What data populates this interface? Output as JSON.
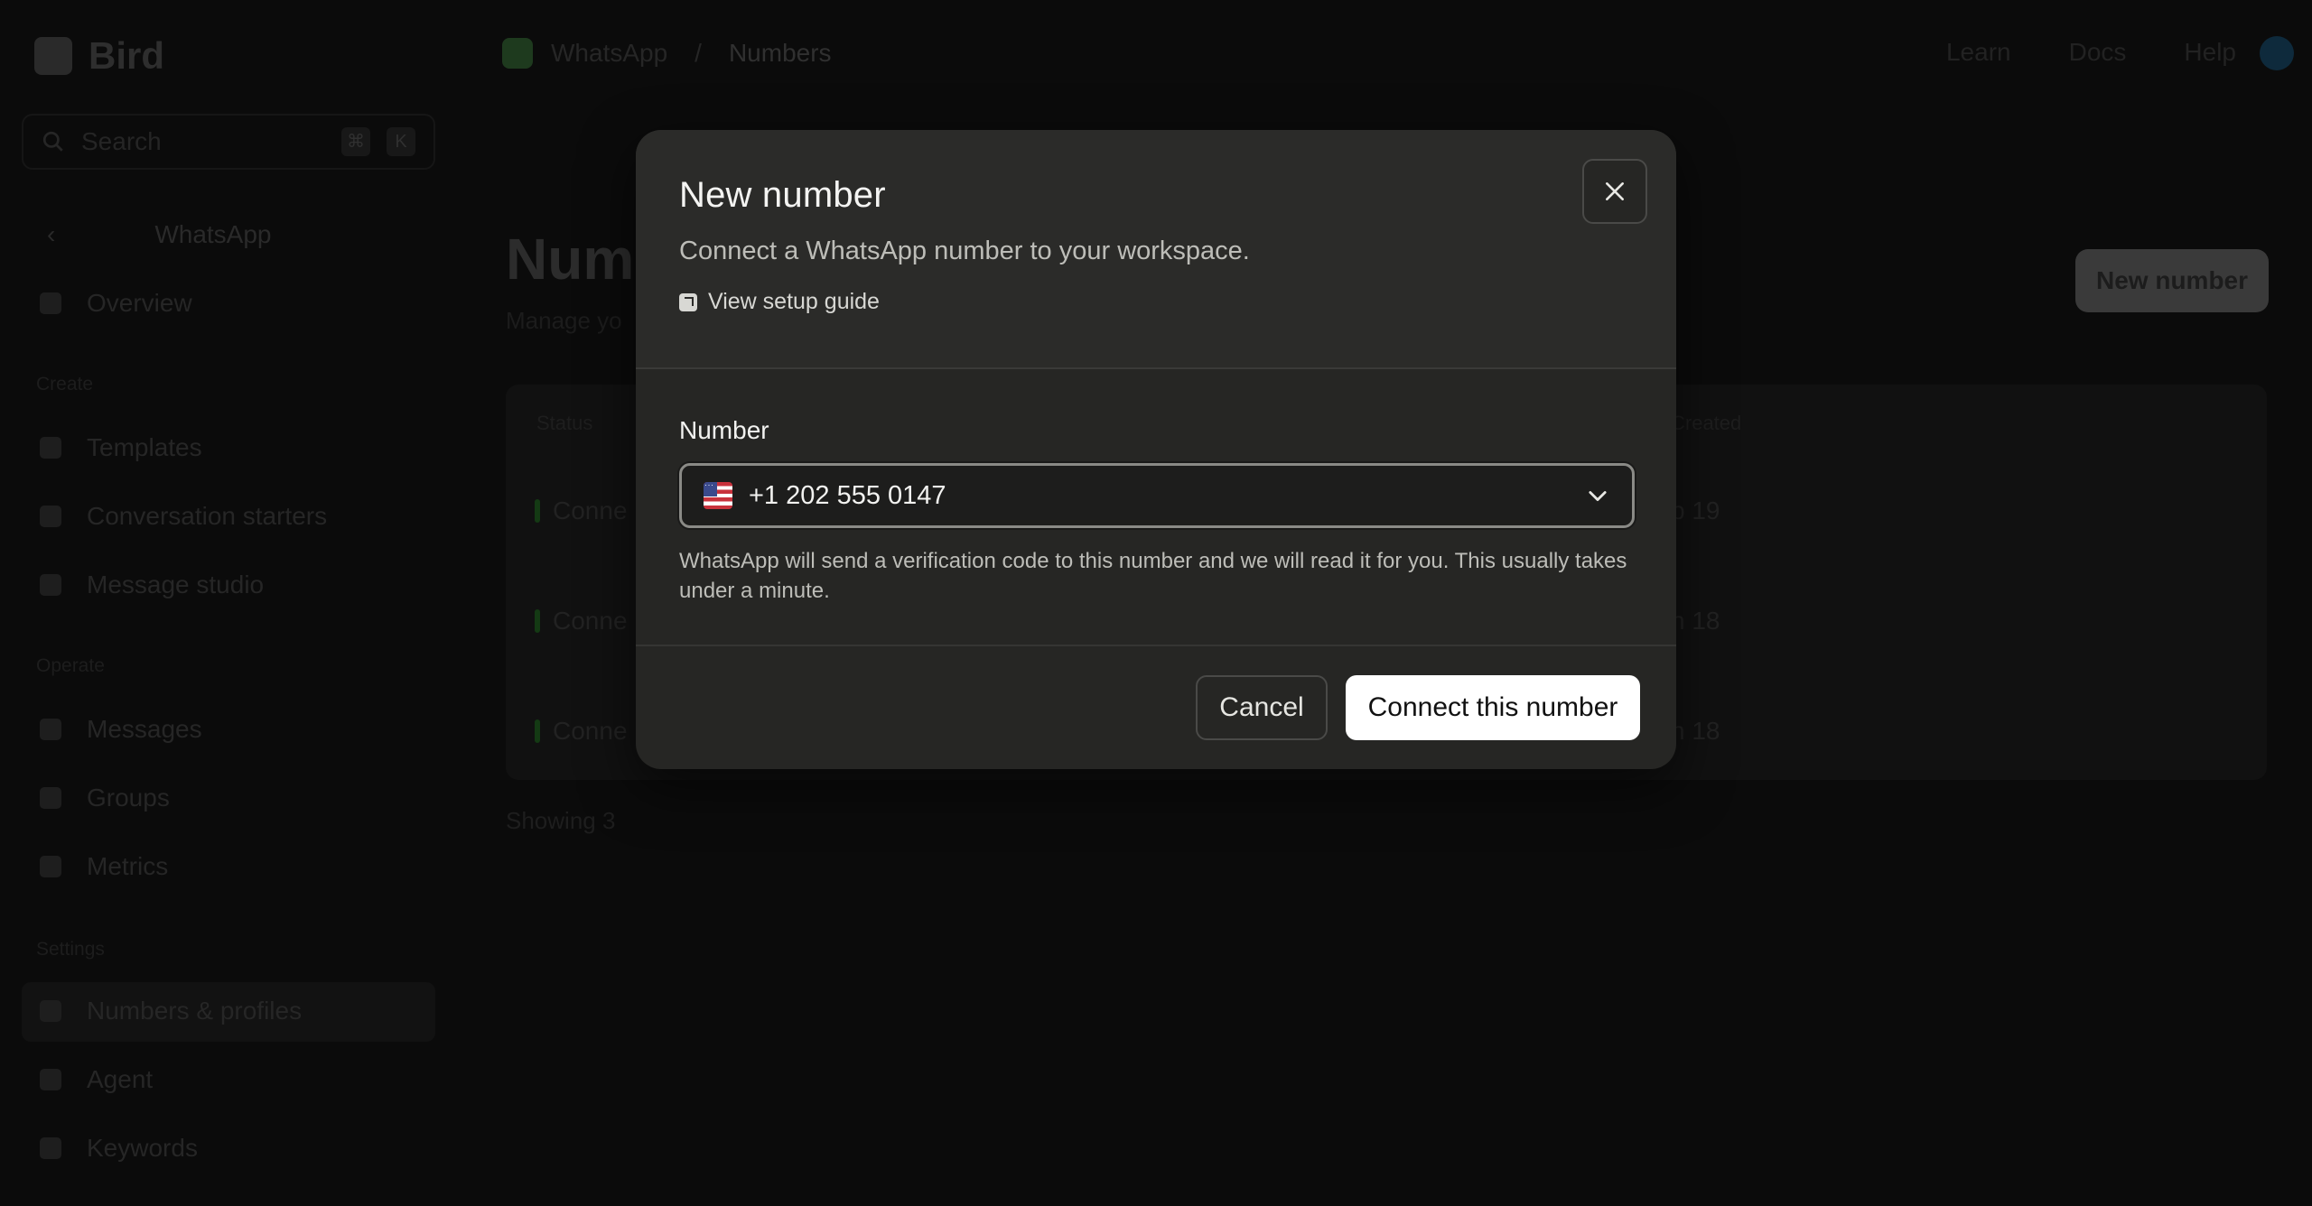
{
  "app": {
    "brand": "Bird",
    "search_placeholder": "Search",
    "shortcut_keys": [
      "⌘",
      "K"
    ],
    "sidebar": {
      "back_title": "WhatsApp",
      "overview": "Overview",
      "sections": [
        {
          "title": "Create",
          "items": [
            "Templates",
            "Conversation starters",
            "Message studio"
          ]
        },
        {
          "title": "Operate",
          "items": [
            "Messages",
            "Groups",
            "Metrics"
          ]
        },
        {
          "title": "Settings",
          "items": [
            "Numbers & profiles",
            "Agent",
            "Keywords"
          ]
        }
      ]
    },
    "breadcrumb": [
      "WhatsApp",
      "Numbers"
    ],
    "top_links": [
      "Learn",
      "Docs",
      "Help"
    ],
    "page": {
      "title": "Numb",
      "subtitle": "Manage yo",
      "new_button": "New number",
      "table_headers": [
        "Status",
        "Created"
      ],
      "rows": [
        {
          "status": "Conne",
          "date": "p 19"
        },
        {
          "status": "Conne",
          "date": "n 18"
        },
        {
          "status": "Conne",
          "date": "n 18"
        }
      ],
      "footer": "Showing 3"
    }
  },
  "modal": {
    "title": "New number",
    "description": "Connect a WhatsApp number to your workspace.",
    "guide_link": "View setup guide",
    "field_label": "Number",
    "selected_number": "+1 202 555 0147",
    "country_flag": "us-flag-icon",
    "help_text": "WhatsApp will send a verification code to this number and we will read it for you. This usually takes under a minute.",
    "cancel_label": "Cancel",
    "connect_label": "Connect this number"
  },
  "colors": {
    "backdrop": "#0b0b0b",
    "modal_bg": "#262624",
    "primary_button": "#ffffff",
    "border": "#4a4a48"
  }
}
